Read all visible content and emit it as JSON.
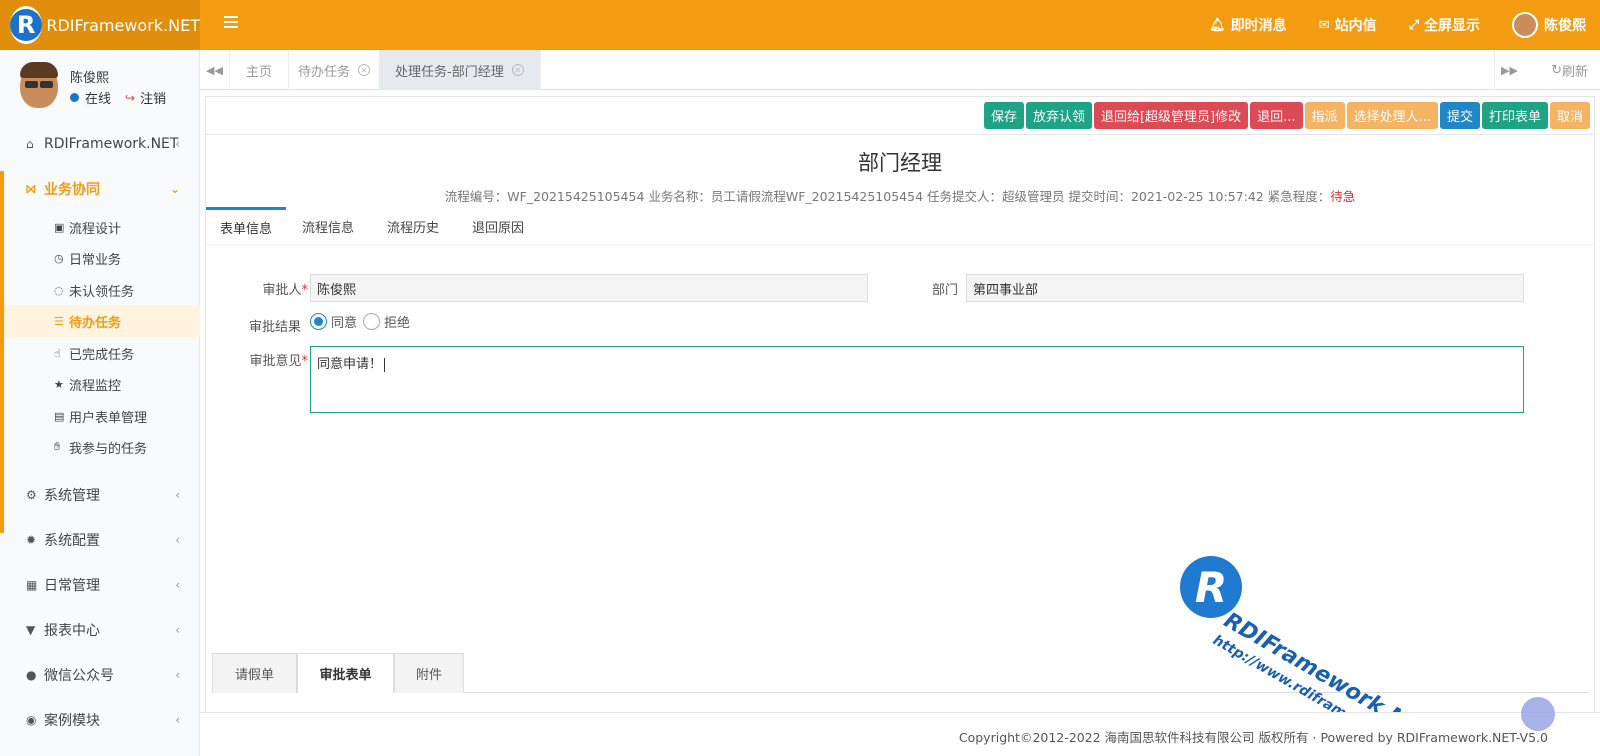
{
  "header": {
    "logo_letter": "R",
    "logo_text": "RDIFramework.NET",
    "items": [
      {
        "icon": "bell-icon",
        "label": "即时消息"
      },
      {
        "icon": "envelope-icon",
        "label": "站内信"
      },
      {
        "icon": "fullscreen-icon",
        "label": "全屏显示"
      }
    ],
    "user_name": "陈俊熙"
  },
  "sidebar": {
    "user_name": "陈俊熙",
    "status": "在线",
    "logout": "注销",
    "top_items": [
      {
        "icon": "home-icon",
        "label": "RDIFramework.NET"
      },
      {
        "icon": "share-icon",
        "label": "业务协同"
      }
    ],
    "sub_items": [
      {
        "icon": "edit-icon",
        "label": "流程设计"
      },
      {
        "icon": "clock-icon",
        "label": "日常业务"
      },
      {
        "icon": "spinner-icon",
        "label": "未认领任务"
      },
      {
        "icon": "tasks-icon",
        "label": "待办任务"
      },
      {
        "icon": "hand-icon",
        "label": "已完成任务"
      },
      {
        "icon": "star-icon",
        "label": "流程监控"
      },
      {
        "icon": "table-icon",
        "label": "用户表单管理"
      },
      {
        "icon": "palm-icon",
        "label": "我参与的任务"
      }
    ],
    "bottom_items": [
      {
        "icon": "cogs-icon",
        "label": "系统管理"
      },
      {
        "icon": "gear-icon",
        "label": "系统配置"
      },
      {
        "icon": "calendar-icon",
        "label": "日常管理"
      },
      {
        "icon": "filter-icon",
        "label": "报表中心"
      },
      {
        "icon": "wechat-icon",
        "label": "微信公众号"
      },
      {
        "icon": "eye-icon",
        "label": "案例模块"
      }
    ]
  },
  "tabbar": {
    "tabs": [
      "主页",
      "待办任务",
      "处理任务-部门经理"
    ],
    "refresh": "刷新"
  },
  "toolbar": {
    "buttons": [
      {
        "label": "保存",
        "color": "#1fa385"
      },
      {
        "label": "放弃认领",
        "color": "#1fa385"
      },
      {
        "label": "退回给[超级管理员]修改",
        "color": "#dc4a55"
      },
      {
        "label": "退回...",
        "color": "#dc4a55"
      },
      {
        "label": "指派",
        "color": "#f4b463"
      },
      {
        "label": "选择处理人...",
        "color": "#f4b463"
      },
      {
        "label": "提交",
        "color": "#1f87c8"
      },
      {
        "label": "打印表单",
        "color": "#1fa385"
      },
      {
        "label": "取消",
        "color": "#f4b463"
      }
    ]
  },
  "form": {
    "title": "部门经理",
    "info": "流程编号：WF_20215425105454 业务名称：员工请假流程WF_20215425105454 任务提交人：超级管理员 提交时间：2021-02-25 10:57:42 紧急程度：",
    "urgency": "待急",
    "tabs": [
      "表单信息",
      "流程信息",
      "流程历史",
      "退回原因"
    ],
    "approver_label": "审批人",
    "approver_value": "陈俊熙",
    "dept_label": "部门",
    "dept_value": "第四事业部",
    "result_label": "审批结果",
    "result_options": [
      "同意",
      "拒绝"
    ],
    "result_selected": "同意",
    "opinion_label": "审批意见",
    "opinion_value": "同意申请！",
    "bottom_tabs": [
      "请假单",
      "审批表单",
      "附件"
    ]
  },
  "watermark": {
    "letter": "R",
    "text": "RDIFramework.NET",
    "url": "http://www.rdiframework.net"
  },
  "footer": {
    "text": "Copyright©2012-2022 海南国思软件科技有限公司 版权所有 · Powered by RDIFramework.NET-V5.0"
  }
}
